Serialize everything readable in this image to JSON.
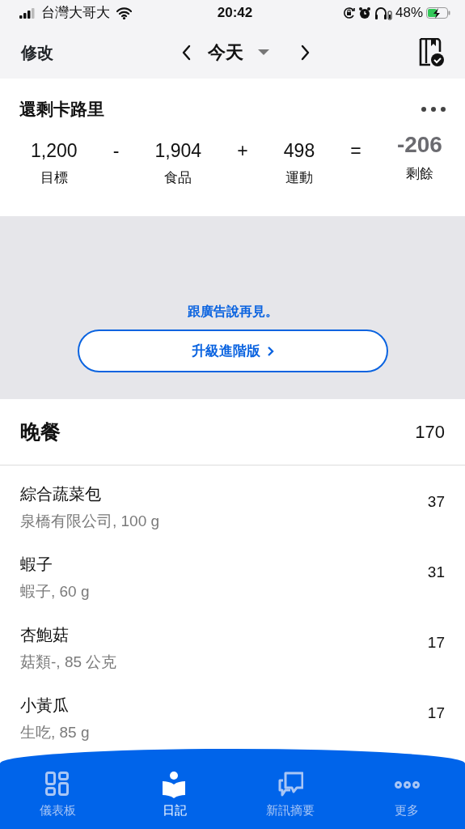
{
  "status_bar": {
    "carrier": "台灣大哥大",
    "time": "20:42",
    "battery": "48%",
    "charging": true
  },
  "header": {
    "edit": "修改",
    "date": "今天"
  },
  "summary": {
    "title": "還剩卡路里",
    "equation": [
      {
        "kind": "term",
        "value": "1,200",
        "label": "目標"
      },
      {
        "kind": "operator",
        "value": "-"
      },
      {
        "kind": "term",
        "value": "1,904",
        "label": "食品"
      },
      {
        "kind": "operator",
        "value": "+"
      },
      {
        "kind": "term",
        "value": "498",
        "label": "運動"
      },
      {
        "kind": "operator",
        "value": "="
      },
      {
        "kind": "result",
        "value": "-206",
        "label": "剩餘"
      }
    ]
  },
  "ad": {
    "text": "跟廣告說再見。",
    "button": "升級進階版"
  },
  "meal": {
    "name": "晚餐",
    "calories": "170",
    "items": [
      {
        "name": "綜合蔬菜包",
        "detail": "泉橋有限公司, 100 g",
        "calories": "37"
      },
      {
        "name": "蝦子",
        "detail": "蝦子, 60 g",
        "calories": "31"
      },
      {
        "name": "杏鮑菇",
        "detail": "菇類-, 85 公克",
        "calories": "17"
      },
      {
        "name": "小黃瓜",
        "detail": "生吃, 85 g",
        "calories": "17"
      }
    ]
  },
  "tabs": [
    {
      "label": "儀表板",
      "kind": "dashboard",
      "selected": false
    },
    {
      "label": "日記",
      "kind": "diary",
      "selected": true
    },
    {
      "label": "新訊摘要",
      "kind": "news",
      "selected": false
    },
    {
      "label": "更多",
      "kind": "more",
      "selected": false
    }
  ]
}
